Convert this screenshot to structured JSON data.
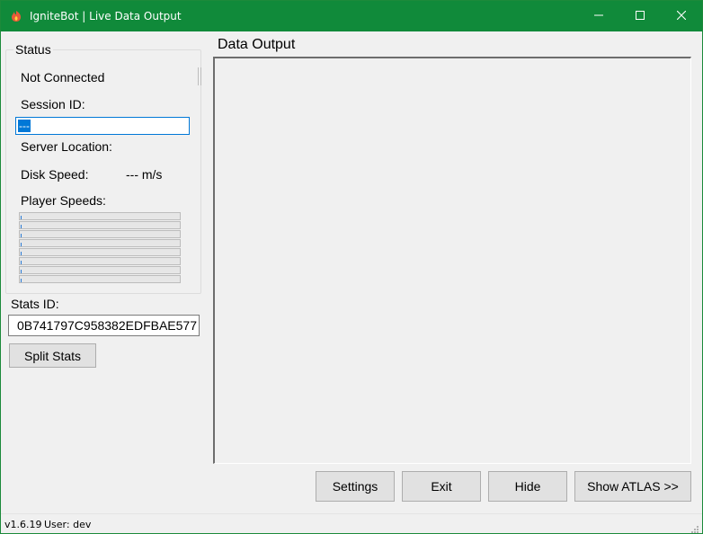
{
  "window": {
    "title": "IgniteBot | Live Data Output",
    "accent_color": "#108a3a",
    "app_icon": "ignitebot-logo-icon"
  },
  "status": {
    "group_title": "Status",
    "connection": "Not Connected",
    "session_id_label": "Session ID:",
    "session_id_value": "---",
    "server_location_label": "Server Location:",
    "disk_speed_label": "Disk Speed:",
    "disk_speed_value": "--- m/s",
    "player_speeds_label": "Player Speeds:",
    "player_speed_levels": [
      0,
      0,
      0,
      0,
      0,
      0,
      0,
      0
    ]
  },
  "stats": {
    "label": "Stats ID:",
    "value": "0B741797C958382EDFBAE577",
    "split_button": "Split Stats"
  },
  "output": {
    "title": "Data Output"
  },
  "buttons": {
    "settings": "Settings",
    "exit": "Exit",
    "hide": "Hide",
    "show_atlas": "Show ATLAS >>"
  },
  "statusbar": {
    "version": "v1.6.19",
    "user": "User: dev"
  }
}
